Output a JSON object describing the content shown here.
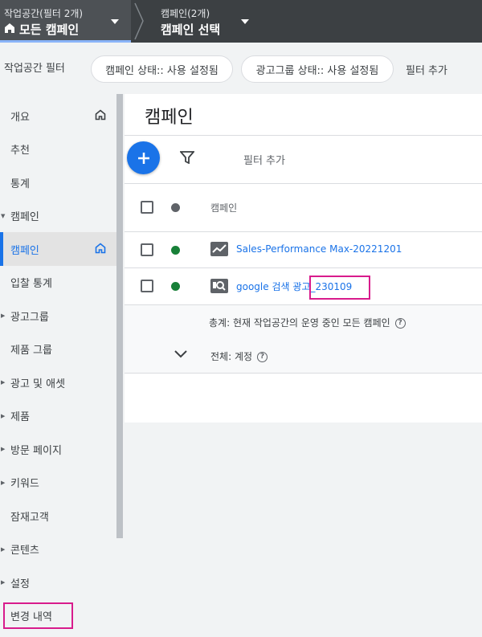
{
  "topbar": {
    "workspace_subtitle": "작업공간(필터 2개)",
    "workspace_title": "모든 캠페인",
    "campaign_subtitle": "캠페인(2개)",
    "campaign_title": "캠페인 선택"
  },
  "filterbar": {
    "label": "작업공간 필터",
    "chips": [
      "캠페인 상태:: 사용 설정됨",
      "광고그룹 상태:: 사용 설정됨"
    ],
    "add_filter": "필터 추가"
  },
  "sidebar": {
    "items": [
      {
        "label": "개요",
        "expandable": false,
        "home_icon": true,
        "active": false
      },
      {
        "label": "추천",
        "expandable": false,
        "home_icon": false,
        "active": false
      },
      {
        "label": "통계",
        "expandable": false,
        "home_icon": false,
        "active": false
      },
      {
        "label": "캠페인",
        "expandable": true,
        "expanded": true,
        "home_icon": false,
        "active": false
      },
      {
        "label": "캠페인",
        "expandable": false,
        "home_icon": true,
        "active": true
      },
      {
        "label": "입찰 통계",
        "expandable": false,
        "home_icon": false,
        "active": false
      },
      {
        "label": "광고그룹",
        "expandable": true,
        "home_icon": false,
        "active": false
      },
      {
        "label": "제품 그룹",
        "expandable": false,
        "home_icon": false,
        "active": false
      },
      {
        "label": "광고 및 애셋",
        "expandable": true,
        "home_icon": false,
        "active": false
      },
      {
        "label": "제품",
        "expandable": true,
        "home_icon": false,
        "active": false
      },
      {
        "label": "방문 페이지",
        "expandable": true,
        "home_icon": false,
        "active": false
      },
      {
        "label": "키워드",
        "expandable": true,
        "home_icon": false,
        "active": false
      },
      {
        "label": "잠재고객",
        "expandable": false,
        "home_icon": false,
        "active": false
      },
      {
        "label": "콘텐츠",
        "expandable": true,
        "home_icon": false,
        "active": false
      },
      {
        "label": "설정",
        "expandable": true,
        "home_icon": false,
        "active": false
      },
      {
        "label": "변경 내역",
        "expandable": false,
        "home_icon": false,
        "active": false,
        "highlighted": true
      }
    ]
  },
  "main": {
    "title": "캠페인",
    "add_button_icon": "plus-icon",
    "filter_placeholder": "필터 추가",
    "table": {
      "column_header": "캠페인",
      "rows": [
        {
          "name": "Sales-Performance Max-20221201",
          "status": "enabled",
          "status_color": "#188038",
          "icon": "performance-max-icon"
        },
        {
          "name_prefix": "google 검색 광고",
          "name_suffix": "_230109",
          "status": "enabled",
          "status_color": "#188038",
          "icon": "search-campaign-icon"
        }
      ],
      "total_label": "총계: 현재 작업공간의 운영 중인 모든 캠페인",
      "all_label": "전체: 계정"
    }
  },
  "colors": {
    "accent": "#1a73e8",
    "highlight": "#d81b8c",
    "topbar": "#3c4043"
  }
}
